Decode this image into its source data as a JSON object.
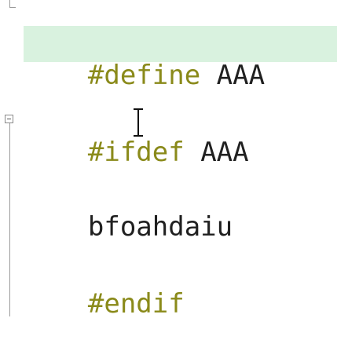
{
  "editor": {
    "lines": [
      {
        "directive": "#define",
        "argument": " AAA"
      },
      {
        "directive": "#ifdef",
        "argument": " AAA"
      },
      {
        "text": "bfoahdaiu"
      },
      {
        "directive": "#endif"
      }
    ]
  },
  "colors": {
    "directive": "#8a8a1a",
    "identifier": "#202020",
    "current_line_highlight": "#d9f2df",
    "fold_marker": "#8a8a8a"
  },
  "icons": {
    "fold_toggle": "collapse-minus-icon",
    "text_cursor": "i-beam-cursor-icon"
  }
}
